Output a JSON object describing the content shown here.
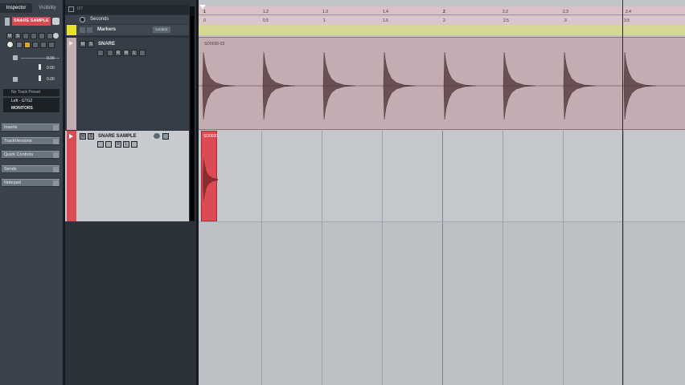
{
  "inspector": {
    "tabs": [
      "Inspector",
      "Visibility"
    ],
    "track_name": "SNARE SAMPLE",
    "fader_value_1": "0.00",
    "fader_value_2": "0.00",
    "fader_value_3": "0.00",
    "track_preset": "No Track Preset",
    "input_routing": "Left - GTG2",
    "output_routing": "MONITORS",
    "sections": [
      "Inserts",
      "TrackVersions",
      "Quick Controls",
      "Sends",
      "Notepad"
    ]
  },
  "tracklist": {
    "header_label": "0/7",
    "tracks": [
      {
        "name": "Seconds"
      },
      {
        "name": "Markers",
        "button": "Locator"
      },
      {
        "name": "SNARE"
      },
      {
        "name": "SNARE SAMPLE"
      }
    ],
    "buttons": {
      "mute": "M",
      "solo": "S",
      "read": "R",
      "write": "W",
      "lanes": "L"
    }
  },
  "ruler": {
    "bar_labels": [
      "1",
      "1.2",
      "1.3",
      "1.4",
      "2",
      "2.2",
      "2.3",
      "2.4"
    ],
    "second_labels": [
      "0",
      "0.5",
      "1",
      "1.5",
      "2",
      "2.5",
      "3",
      "3.5"
    ]
  },
  "events": {
    "snare_event_name": "SD0030-03",
    "sample_event_name": "SD0030"
  },
  "colors": {
    "snare_event_bg": "#c4adb2",
    "sample_event_bg": "#dc4a52",
    "selected_track": "#c7cbcf",
    "markers_lane": "#d4d890"
  }
}
